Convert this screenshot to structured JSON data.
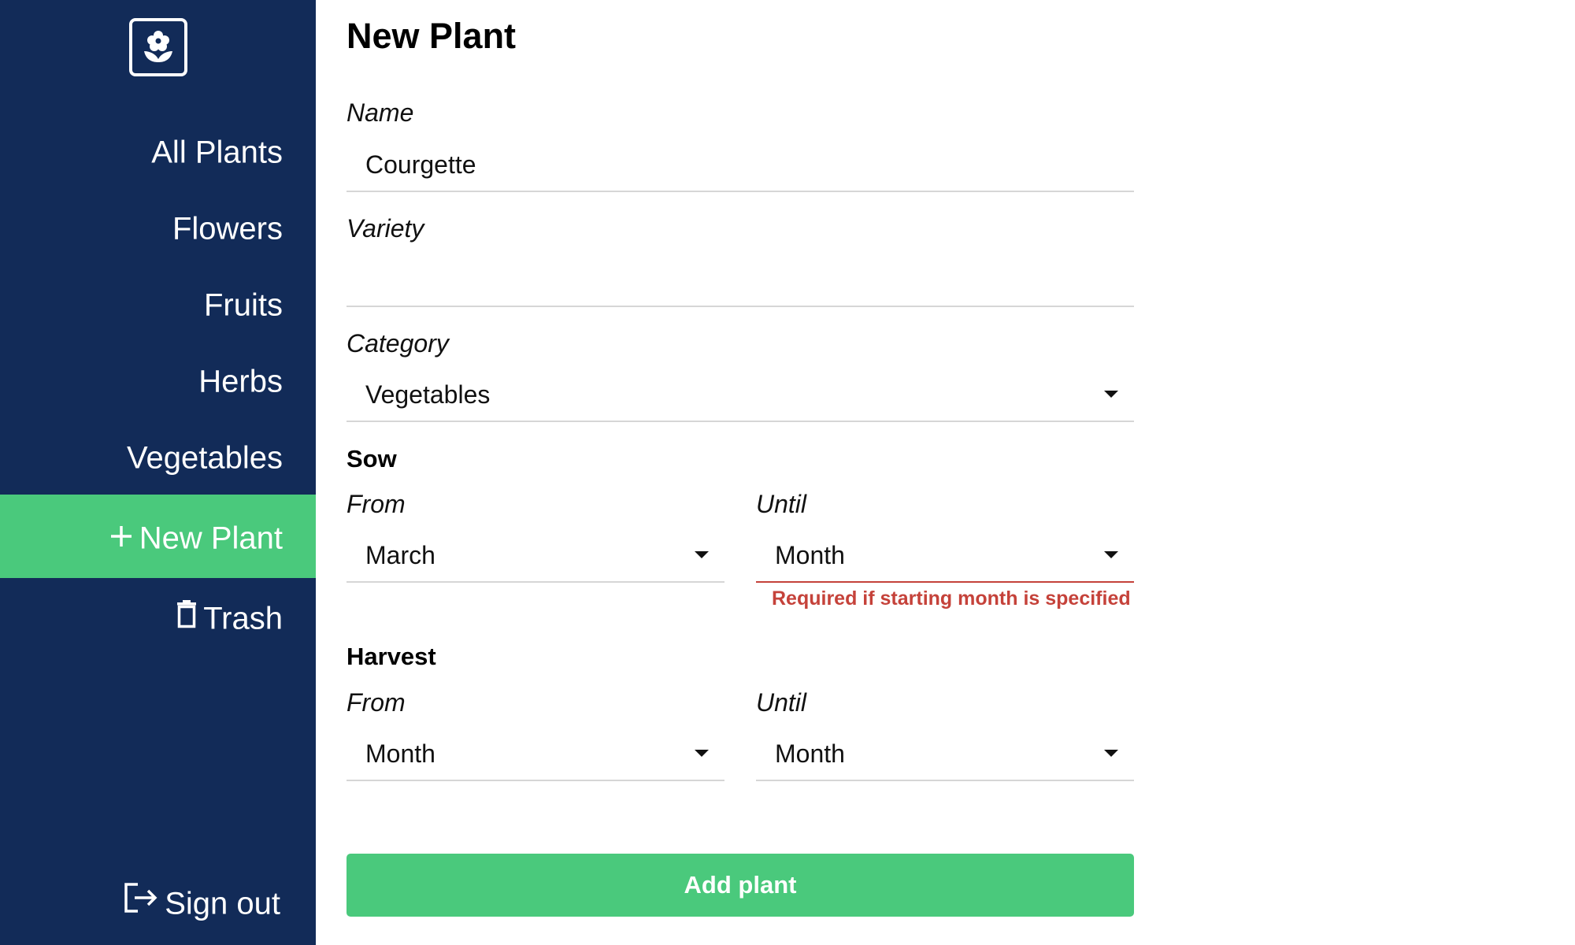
{
  "sidebar": {
    "logo_icon": "flower-icon",
    "items": [
      {
        "label": "All Plants"
      },
      {
        "label": "Flowers"
      },
      {
        "label": "Fruits"
      },
      {
        "label": "Herbs"
      },
      {
        "label": "Vegetables"
      },
      {
        "label": "New Plant",
        "icon": "plus-icon",
        "active": true
      },
      {
        "label": "Trash",
        "icon": "trash-icon"
      }
    ],
    "sign_out": {
      "label": "Sign out",
      "icon": "sign-out-icon"
    }
  },
  "form": {
    "title": "New Plant",
    "name": {
      "label": "Name",
      "value": "Courgette"
    },
    "variety": {
      "label": "Variety",
      "value": ""
    },
    "category": {
      "label": "Category",
      "value": "Vegetables"
    },
    "sow": {
      "heading": "Sow",
      "from": {
        "label": "From",
        "value": "March"
      },
      "until": {
        "label": "Until",
        "value": "Month",
        "error": "Required if starting month is specified"
      }
    },
    "harvest": {
      "heading": "Harvest",
      "from": {
        "label": "From",
        "value": "Month"
      },
      "until": {
        "label": "Until",
        "value": "Month"
      }
    },
    "submit_label": "Add plant"
  },
  "colors": {
    "sidebar_bg": "#122b58",
    "accent": "#4ac97c",
    "error": "#c5423a"
  }
}
